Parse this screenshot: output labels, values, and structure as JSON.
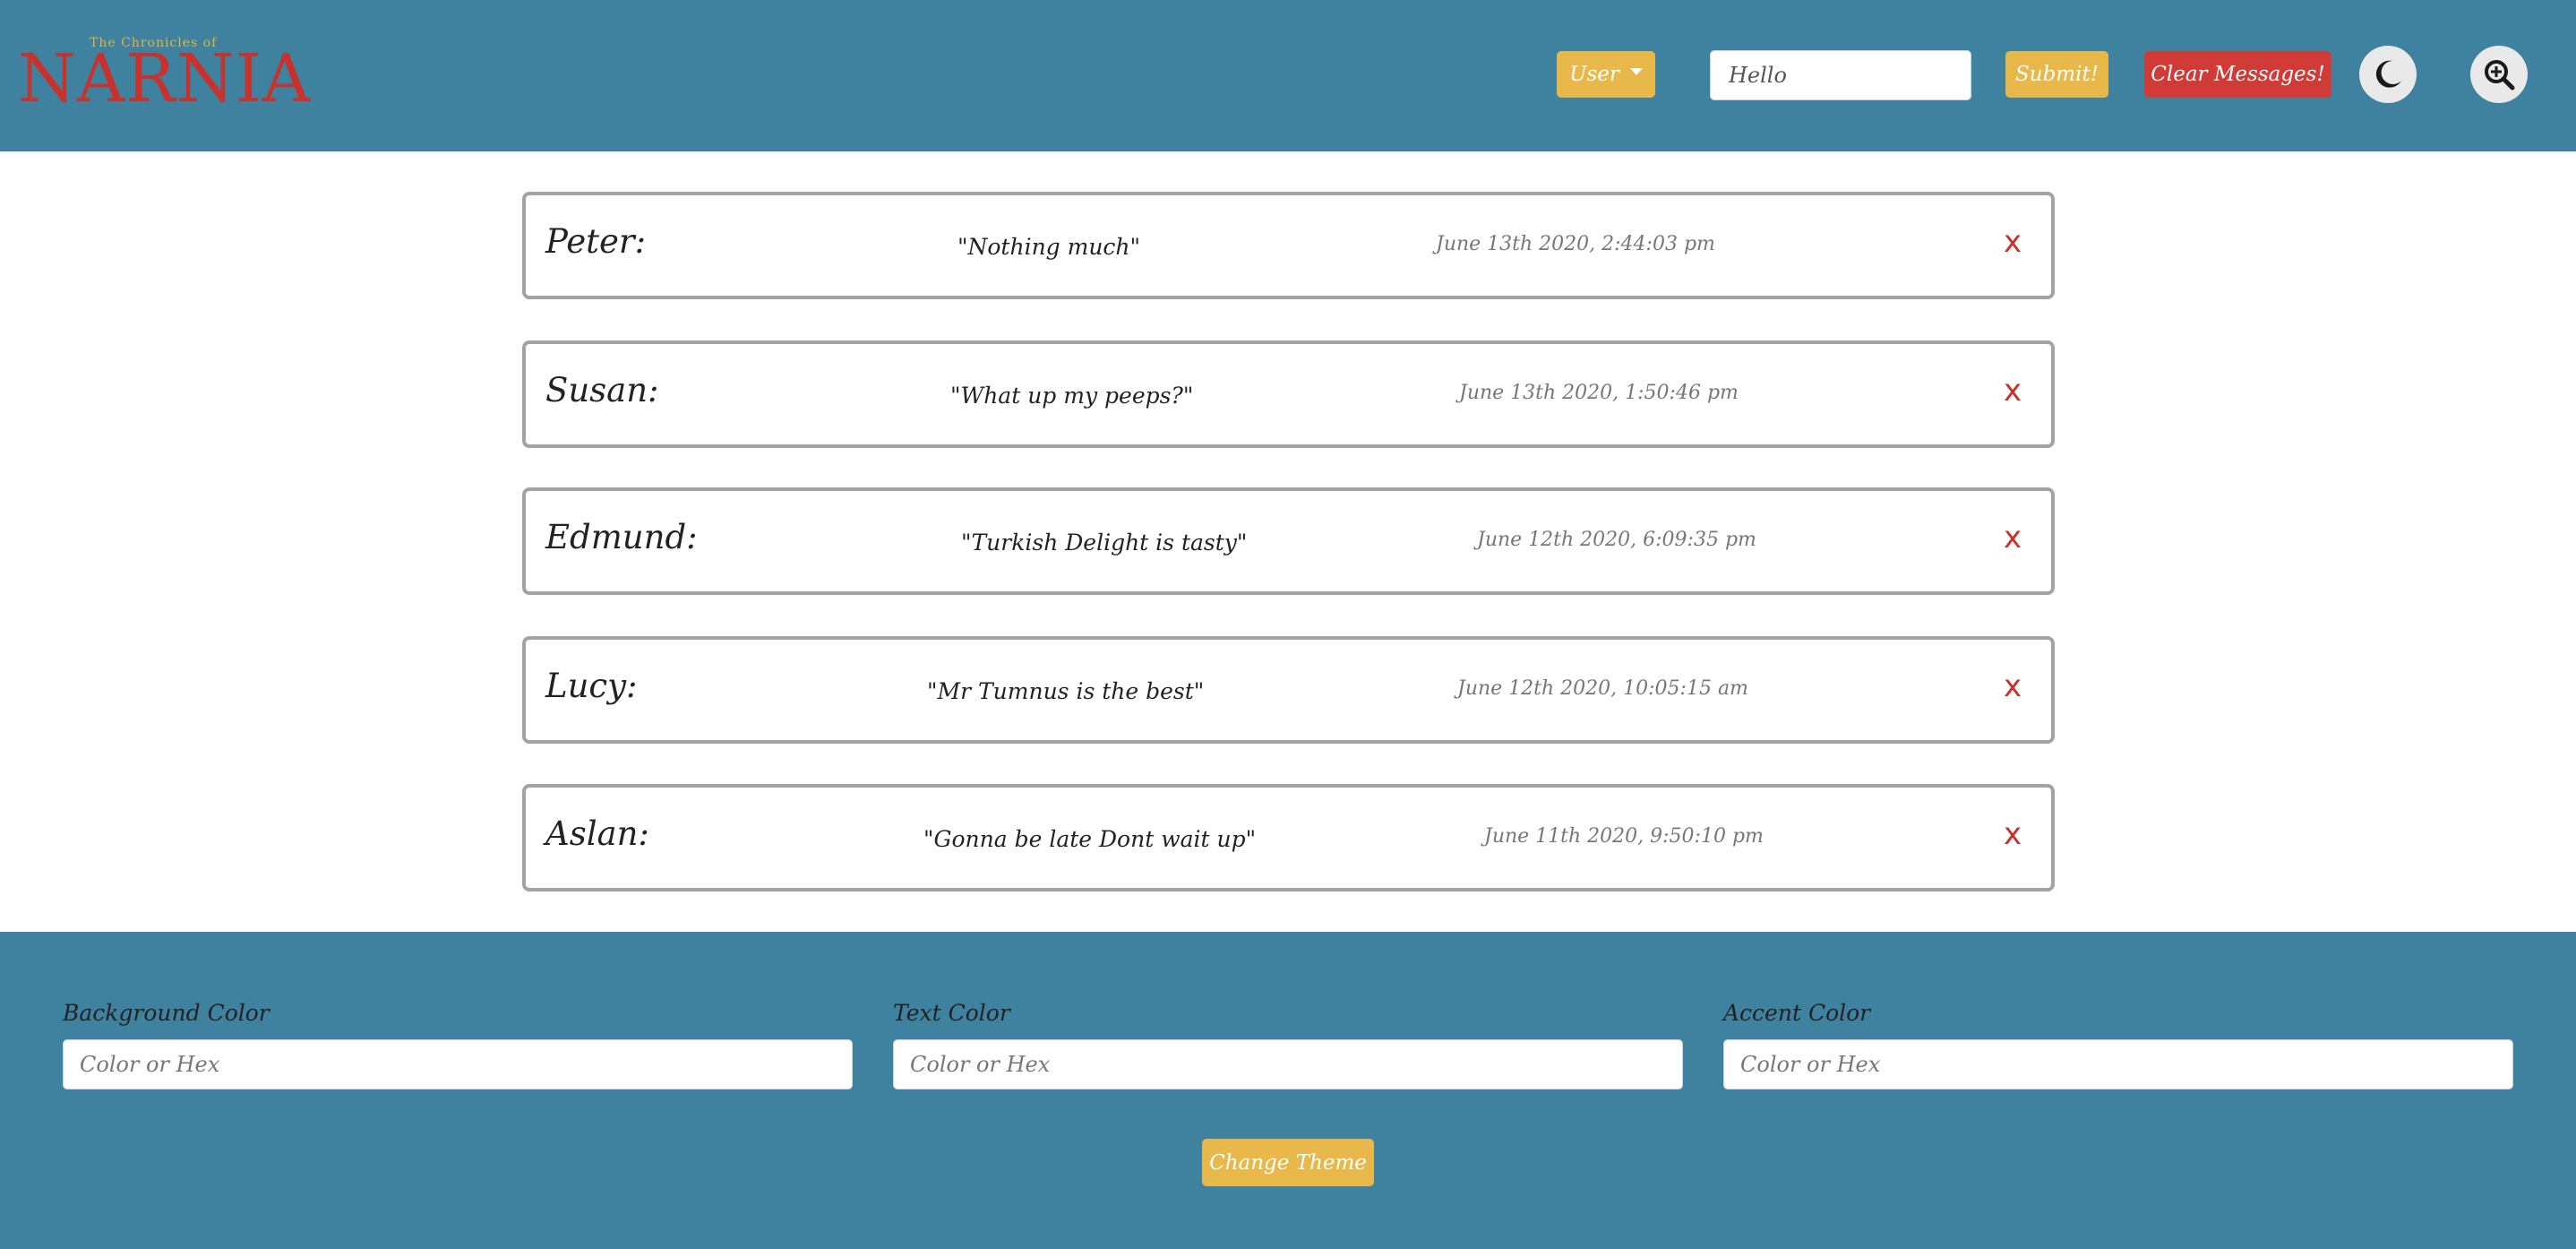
{
  "header": {
    "logo_small": "The Chronicles of",
    "logo_big": "NARNIA",
    "user_dropdown_label": "User",
    "message_input_value": "Hello",
    "submit_label": "Submit!",
    "clear_label": "Clear Messages!",
    "dark_mode_icon": "moon-icon",
    "zoom_icon": "zoom-in-icon"
  },
  "messages": [
    {
      "name": "Peter:",
      "text": "\"Nothing much\"",
      "time": "June 13th 2020, 2:44:03 pm",
      "delete": "x"
    },
    {
      "name": "Susan:",
      "text": "\"What up my peeps?\"",
      "time": "June 13th 2020, 1:50:46 pm",
      "delete": "x"
    },
    {
      "name": "Edmund:",
      "text": "\"Turkish Delight is tasty\"",
      "time": "June 12th 2020, 6:09:35 pm",
      "delete": "x"
    },
    {
      "name": "Lucy:",
      "text": "\"Mr Tumnus is the best\"",
      "time": "June 12th 2020, 10:05:15 am",
      "delete": "x"
    },
    {
      "name": "Aslan:",
      "text": "\"Gonna be late Dont wait up\"",
      "time": "June 11th 2020, 9:50:10 pm",
      "delete": "x"
    }
  ],
  "theme": {
    "background_label": "Background Color",
    "text_label": "Text Color",
    "accent_label": "Accent Color",
    "placeholder": "Color or Hex",
    "change_theme_label": "Change Theme"
  },
  "colors": {
    "header_bg": "#3e829f",
    "button_yellow": "#e8b84a",
    "button_red": "#d03b37",
    "delete_red": "#c7322c"
  }
}
